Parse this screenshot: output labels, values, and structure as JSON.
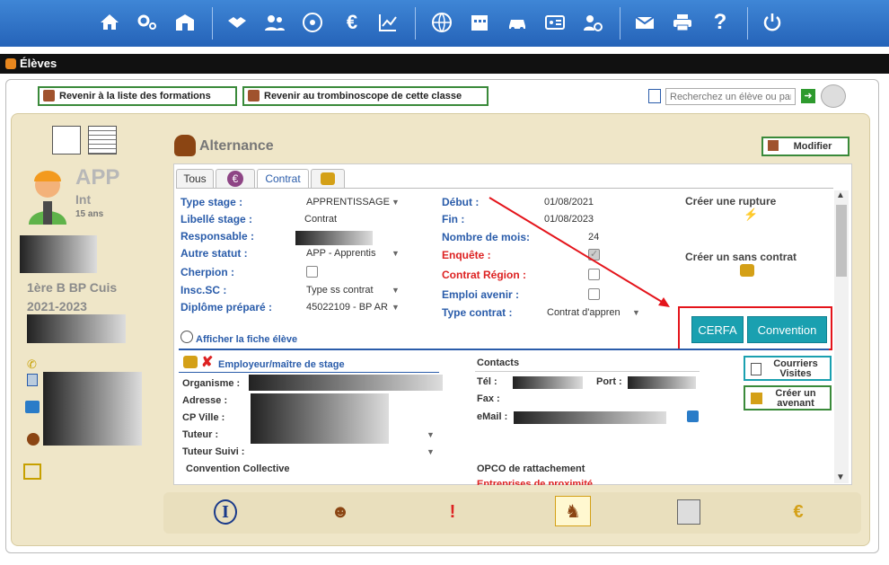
{
  "window": {
    "title": "Élèves"
  },
  "toolbar": {
    "back_formations": "Revenir à la liste des formations",
    "back_trombi": "Revenir au trombinoscope de cette classe",
    "search_placeholder": "Recherchez un élève ou par"
  },
  "student": {
    "status": "APP",
    "sub": "Int",
    "age": "15 ans",
    "class": "1ère B BP Cuis",
    "year": "2021-2023"
  },
  "section": {
    "title": "Alternance",
    "modify": "Modifier"
  },
  "tabs": [
    {
      "label": "Tous"
    },
    {
      "label": "€"
    },
    {
      "label": "Contrat"
    }
  ],
  "contract": {
    "type_stage_l": "Type stage :",
    "type_stage_v": "APPRENTISSAGE",
    "libelle_l": "Libellé stage :",
    "libelle_v": "Contrat",
    "resp_l": "Responsable :",
    "autre_l": "Autre statut :",
    "autre_v": "APP - Apprentis",
    "cherpion_l": "Cherpion :",
    "insc_l": "Insc.SC :",
    "insc_v": "Type ss contrat",
    "diplome_l": "Diplôme préparé :",
    "diplome_v": "45022109 - BP AR",
    "debut_l": "Début :",
    "debut_v": "01/08/2021",
    "fin_l": "Fin :",
    "fin_v": "01/08/2023",
    "nbmois_l": "Nombre de mois:",
    "nbmois_v": "24",
    "enquete_l": "Enquête :",
    "region_l": "Contrat Région :",
    "emploi_l": "Emploi avenir :",
    "typec_l": "Type contrat :",
    "typec_v": "Contrat d'appren"
  },
  "actions": {
    "rupture": "Créer une rupture",
    "sans_contrat": "Créer un sans contrat",
    "cerfa": "CERFA",
    "convention": "Convention",
    "fiche": "Afficher la fiche élève",
    "courriers": "Courriers Visites",
    "avenant": "Créer un avenant"
  },
  "employer": {
    "title": "Employeur/maître de stage",
    "org": "Organisme :",
    "adresse": "Adresse :",
    "cpville": "CP Ville :",
    "tuteur": "Tuteur :",
    "tuteur_suivi": "Tuteur Suivi :",
    "convention": "Convention Collective"
  },
  "contacts": {
    "title": "Contacts",
    "tel": "Tél :",
    "port": "Port :",
    "fax": "Fax :",
    "email": "eMail :",
    "opco": "OPCO de rattachement",
    "proximite": "Entreprises de proximité"
  },
  "colors": {
    "accent": "#1aa0b0",
    "link": "#2a5caa",
    "alert": "#e4141b"
  }
}
